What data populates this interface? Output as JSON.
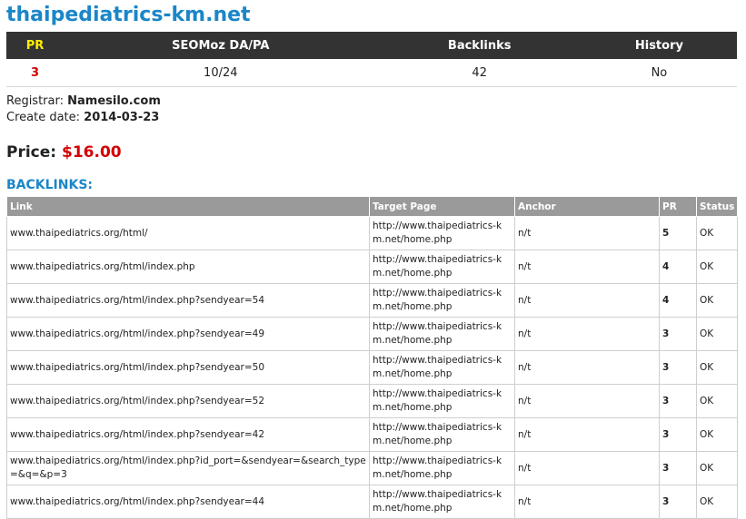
{
  "domain": "thaipediatrics-km.net",
  "stats": {
    "headers": {
      "pr": "PR",
      "seomoz": "SEOMoz DA/PA",
      "backlinks": "Backlinks",
      "history": "History"
    },
    "values": {
      "pr": "3",
      "seomoz": "10/24",
      "backlinks": "42",
      "history": "No"
    }
  },
  "info": {
    "registrar_label": "Registrar:",
    "registrar_value": "Namesilo.com",
    "create_label": "Create date:",
    "create_value": "2014-03-23"
  },
  "price": {
    "label": "Price:",
    "value": "$16.00"
  },
  "backlinks_section": {
    "title": "BACKLINKS:",
    "columns": [
      "Link",
      "Target Page",
      "Anchor",
      "PR",
      "Status"
    ],
    "rows": [
      {
        "link": "www.thaipediatrics.org/html/",
        "target": "http://www.thaipediatrics-km.net/home.php",
        "anchor": "n/t",
        "pr": "5",
        "status": "OK"
      },
      {
        "link": "www.thaipediatrics.org/html/index.php",
        "target": "http://www.thaipediatrics-km.net/home.php",
        "anchor": "n/t",
        "pr": "4",
        "status": "OK"
      },
      {
        "link": "www.thaipediatrics.org/html/index.php?sendyear=54",
        "target": "http://www.thaipediatrics-km.net/home.php",
        "anchor": "n/t",
        "pr": "4",
        "status": "OK"
      },
      {
        "link": "www.thaipediatrics.org/html/index.php?sendyear=49",
        "target": "http://www.thaipediatrics-km.net/home.php",
        "anchor": "n/t",
        "pr": "3",
        "status": "OK"
      },
      {
        "link": "www.thaipediatrics.org/html/index.php?sendyear=50",
        "target": "http://www.thaipediatrics-km.net/home.php",
        "anchor": "n/t",
        "pr": "3",
        "status": "OK"
      },
      {
        "link": "www.thaipediatrics.org/html/index.php?sendyear=52",
        "target": "http://www.thaipediatrics-km.net/home.php",
        "anchor": "n/t",
        "pr": "3",
        "status": "OK"
      },
      {
        "link": "www.thaipediatrics.org/html/index.php?sendyear=42",
        "target": "http://www.thaipediatrics-km.net/home.php",
        "anchor": "n/t",
        "pr": "3",
        "status": "OK"
      },
      {
        "link": "www.thaipediatrics.org/html/index.php?id_port=&sendyear=&search_type=&q=&p=3",
        "target": "http://www.thaipediatrics-km.net/home.php",
        "anchor": "n/t",
        "pr": "3",
        "status": "OK"
      },
      {
        "link": "www.thaipediatrics.org/html/index.php?sendyear=44",
        "target": "http://www.thaipediatrics-km.net/home.php",
        "anchor": "n/t",
        "pr": "3",
        "status": "OK"
      }
    ]
  }
}
